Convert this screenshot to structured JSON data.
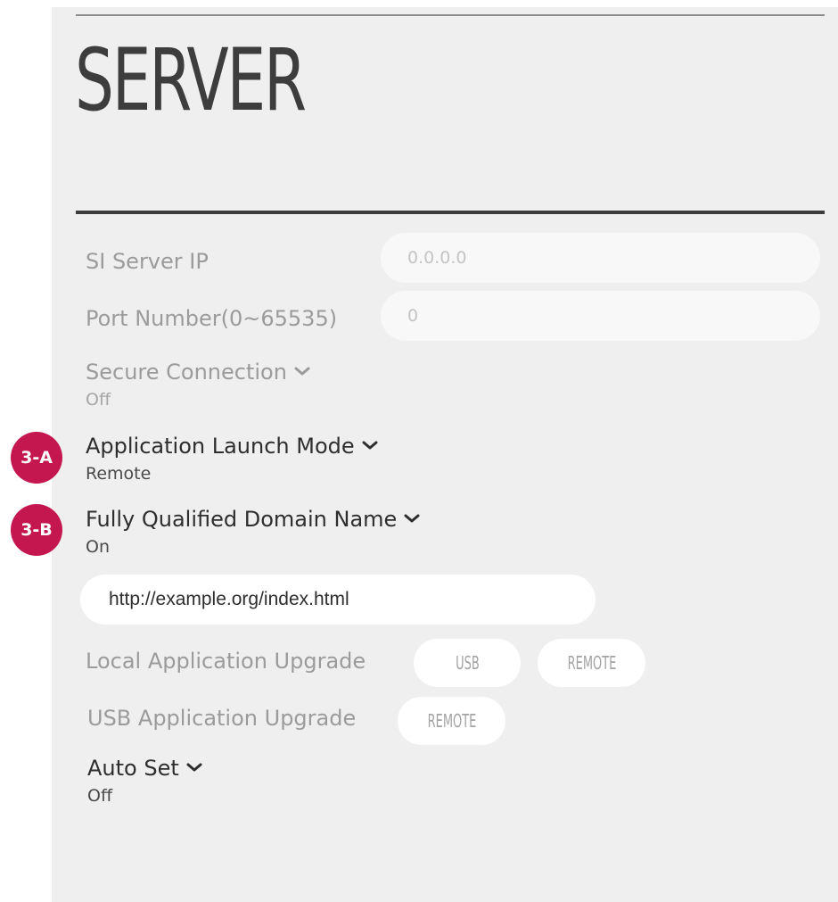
{
  "page": {
    "title": "SERVER"
  },
  "settings": {
    "si_server_ip": {
      "label": "SI Server IP",
      "placeholder": "0.0.0.0"
    },
    "port_number": {
      "label": "Port Number(0~65535)",
      "placeholder": "0"
    },
    "secure_connection": {
      "label": "Secure Connection",
      "value": "Off"
    },
    "application_launch_mode": {
      "label": "Application Launch Mode",
      "value": "Remote"
    },
    "fqdn": {
      "label": "Fully Qualified Domain Name",
      "value": "On",
      "url": "http://example.org/index.html"
    },
    "local_application_upgrade": {
      "label": "Local Application Upgrade",
      "options": [
        "USB",
        "REMOTE"
      ]
    },
    "usb_application_upgrade": {
      "label": "USB Application Upgrade",
      "options": [
        "REMOTE"
      ]
    },
    "auto_set": {
      "label": "Auto Set",
      "value": "Off"
    }
  },
  "annotations": {
    "badge_a": "3-A",
    "badge_b": "3-B"
  },
  "colors": {
    "badge": "#c4174f",
    "panel_bg": "#efefef",
    "title": "#3d3d3d",
    "muted_text": "#9b9b9b",
    "active_text": "#2e2e2e"
  },
  "icons": {
    "dropdown": "chevron-down-icon"
  }
}
